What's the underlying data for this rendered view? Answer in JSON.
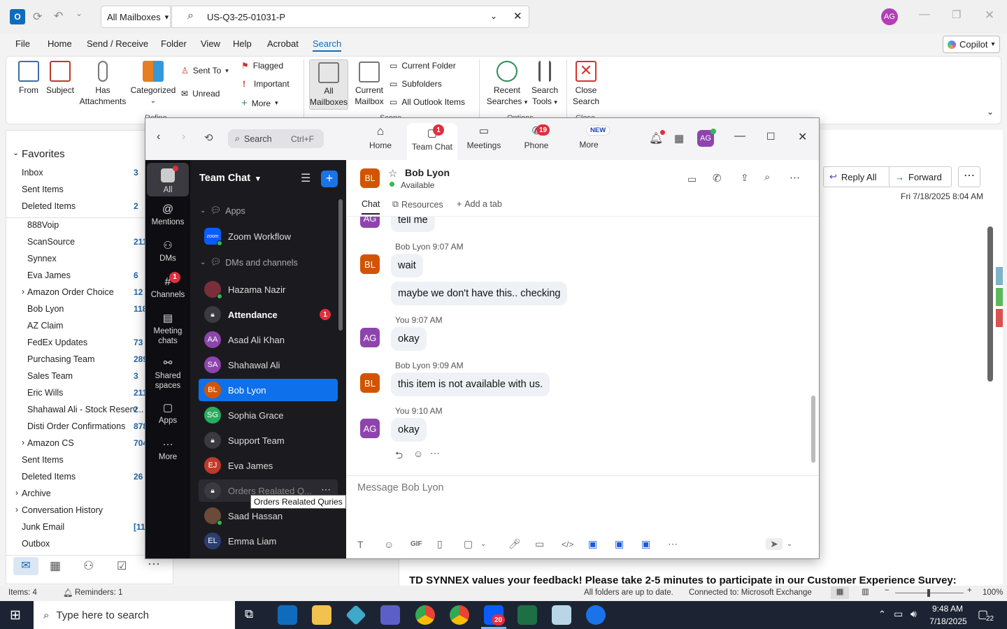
{
  "outlook": {
    "mailbox_scope": "All Mailboxes",
    "search_query": "US-Q3-25-01031-P",
    "user_initials": "AG",
    "menu": [
      "File",
      "Home",
      "Send / Receive",
      "Folder",
      "View",
      "Help",
      "Acrobat",
      "Search"
    ],
    "active_menu": "Search",
    "copilot": "Copilot",
    "ribbon": {
      "from": "From",
      "subject": "Subject",
      "has_attachments_1": "Has",
      "has_attachments_2": "Attachments",
      "categorized": "Categorized",
      "sent_to": "Sent To",
      "unread": "Unread",
      "flagged": "Flagged",
      "important": "Important",
      "more": "More",
      "refine_group": "Refine",
      "all_mailboxes_1": "All",
      "all_mailboxes_2": "Mailboxes",
      "current_mailbox_1": "Current",
      "current_mailbox_2": "Mailbox",
      "current_folder": "Current Folder",
      "subfolders": "Subfolders",
      "all_outlook_items": "All Outlook Items",
      "scope_group": "Scope",
      "recent_searches_1": "Recent",
      "recent_searches_2": "Searches",
      "search_tools_1": "Search",
      "search_tools_2": "Tools",
      "options_group": "Options",
      "close_search_1": "Close",
      "close_search_2": "Search",
      "close_group": "Close"
    },
    "favorites_title": "Favorites",
    "folders": [
      {
        "name": "Inbox",
        "count": "3"
      },
      {
        "name": "Sent Items",
        "count": ""
      },
      {
        "name": "Deleted Items",
        "count": "2"
      },
      {
        "name": "888Voip",
        "count": ""
      },
      {
        "name": "ScanSource",
        "count": "211"
      },
      {
        "name": "Synnex",
        "count": ""
      },
      {
        "name": "Eva James",
        "count": "6"
      },
      {
        "name": "Amazon Order Choice",
        "count": "12"
      },
      {
        "name": "Bob Lyon",
        "count": "118"
      },
      {
        "name": "AZ Claim",
        "count": ""
      },
      {
        "name": "FedEx Updates",
        "count": "73"
      },
      {
        "name": "Purchasing Team",
        "count": "289"
      },
      {
        "name": "Sales Team",
        "count": "3"
      },
      {
        "name": "Eric Wills",
        "count": "211"
      },
      {
        "name": "Shahawal Ali - Stock Reserv...",
        "count": "2"
      },
      {
        "name": "Disti Order Confirmations",
        "count": "878"
      },
      {
        "name": "Amazon CS",
        "count": "704"
      },
      {
        "name": "Sent Items",
        "count": ""
      },
      {
        "name": "Deleted Items",
        "count": "26"
      },
      {
        "name": "Archive",
        "count": ""
      },
      {
        "name": "Conversation History",
        "count": ""
      },
      {
        "name": "Junk Email",
        "count": "[11"
      },
      {
        "name": "Outbox",
        "count": ""
      }
    ],
    "reply_all": "Reply All",
    "forward": "Forward",
    "email_date": "Fri 7/18/2025 8:04 AM",
    "email_body": "TD SYNNEX values your feedback! Please take 2-5 minutes to participate in our Customer Experience Survey:",
    "status_items": "Items: 4",
    "status_reminders": "Reminders: 1",
    "status_sync": "All folders are up to date.",
    "status_connection": "Connected to: Microsoft Exchange",
    "zoom_level": "100%"
  },
  "zoom": {
    "search_placeholder": "Search",
    "search_shortcut": "Ctrl+F",
    "tabs": [
      {
        "label": "Home",
        "badge": ""
      },
      {
        "label": "Team Chat",
        "badge": "1"
      },
      {
        "label": "Meetings",
        "badge": ""
      },
      {
        "label": "Phone",
        "badge": "19"
      },
      {
        "label": "More",
        "badge": "NEW"
      }
    ],
    "user_initials": "AG",
    "rail": [
      {
        "label": "All",
        "badge": ""
      },
      {
        "label": "Mentions",
        "badge": ""
      },
      {
        "label": "DMs",
        "badge": ""
      },
      {
        "label": "Channels",
        "badge": "1"
      },
      {
        "label": "Meeting chats",
        "badge": ""
      },
      {
        "label": "Shared spaces",
        "badge": ""
      },
      {
        "label": "Apps",
        "badge": ""
      },
      {
        "label": "More",
        "badge": ""
      }
    ],
    "list_title": "Team Chat",
    "section_apps": "Apps",
    "app_zoom_workflow": "Zoom Workflow",
    "section_dms": "DMs and channels",
    "contacts": [
      {
        "name": "Hazama Nazir",
        "initials": "",
        "color": "#7a2e3a",
        "bold": false
      },
      {
        "name": "Attendance",
        "initials": "",
        "color": "#444",
        "bold": true,
        "badge": "1"
      },
      {
        "name": "Asad Ali Khan",
        "initials": "AA",
        "color": "#8e44ad",
        "bold": false
      },
      {
        "name": "Shahawal Ali",
        "initials": "SA",
        "color": "#8e44ad",
        "bold": false
      },
      {
        "name": "Bob Lyon",
        "initials": "BL",
        "color": "#d35400",
        "bold": false
      },
      {
        "name": "Sophia Grace",
        "initials": "SG",
        "color": "#27ae60",
        "bold": false
      },
      {
        "name": "Support Team",
        "initials": "",
        "color": "#444",
        "bold": false
      },
      {
        "name": "Eva James",
        "initials": "EJ",
        "color": "#c0392b",
        "bold": false
      },
      {
        "name": "Orders Realated Q...",
        "initials": "",
        "color": "#444",
        "bold": false
      },
      {
        "name": "Saad Hassan",
        "initials": "",
        "color": "#6b4a3a",
        "bold": false
      },
      {
        "name": "Emma Liam",
        "initials": "EL",
        "color": "#2c3e70",
        "bold": false
      }
    ],
    "tooltip": "Orders Realated Quries",
    "chat": {
      "contact_name": "Bob Lyon",
      "contact_initials": "BL",
      "status": "Available",
      "tab_chat": "Chat",
      "tab_resources": "Resources",
      "tab_add": "Add a tab",
      "messages": [
        {
          "who": "AG",
          "meta": "",
          "text": "tell me"
        },
        {
          "who": "BL",
          "meta": "Bob Lyon 9:07 AM",
          "text": "wait"
        },
        {
          "who": "",
          "meta": "",
          "text": "maybe we don't have this.. checking"
        },
        {
          "who": "AG",
          "meta": "You 9:07 AM",
          "text": "okay"
        },
        {
          "who": "BL",
          "meta": "Bob Lyon 9:09 AM",
          "text": "this item is not available with us."
        },
        {
          "who": "AG",
          "meta": "You 9:10 AM",
          "text": "okay"
        }
      ],
      "composer_placeholder": "Message Bob Lyon"
    }
  },
  "taskbar": {
    "search_placeholder": "Type here to search",
    "time": "9:48 AM",
    "date": "7/18/2025",
    "notifications": "22",
    "zoom_badge": "20"
  }
}
